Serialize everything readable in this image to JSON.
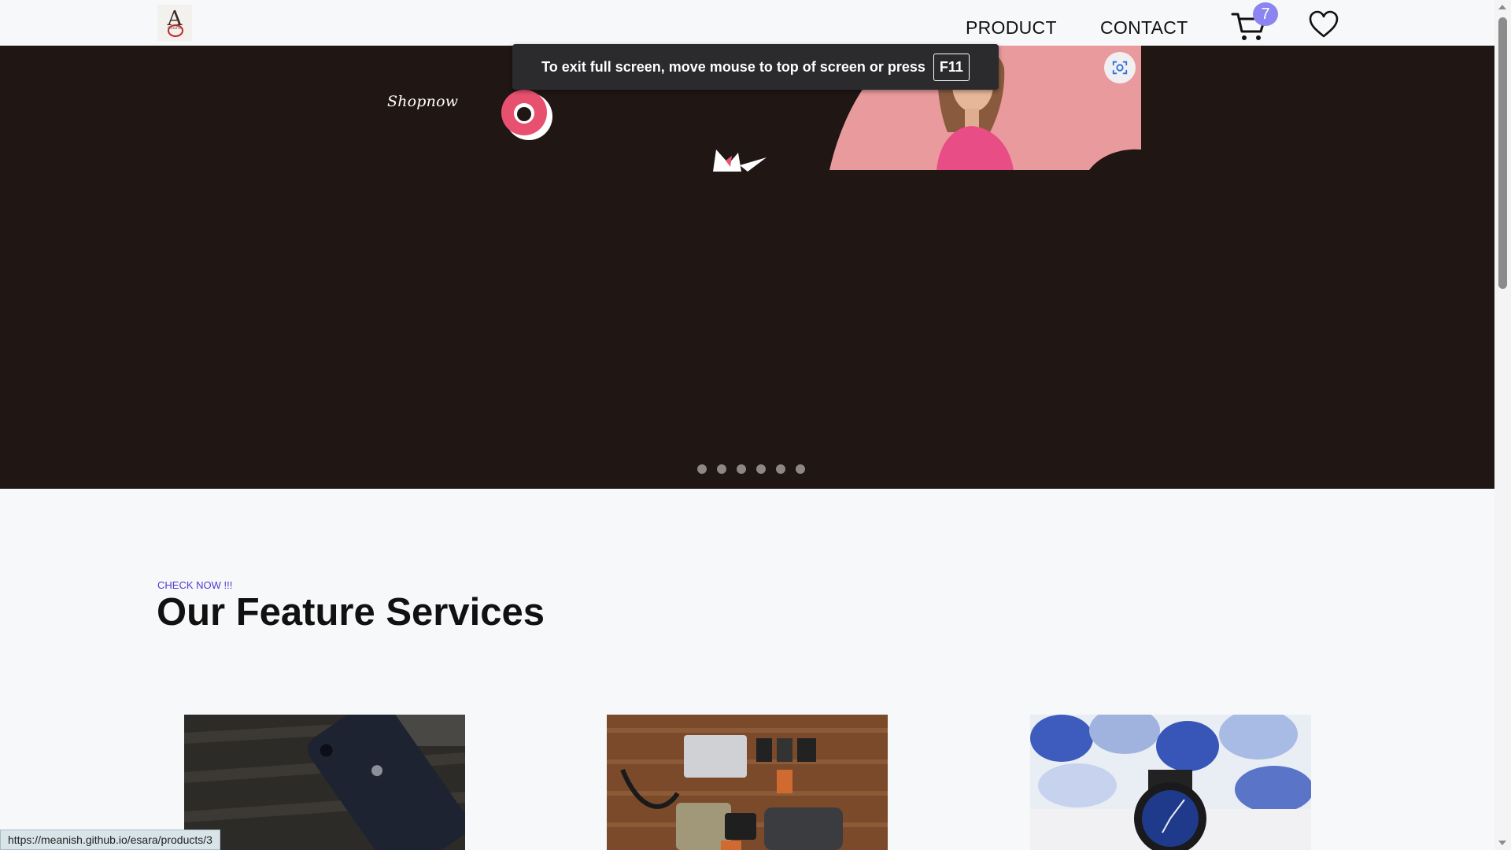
{
  "navbar": {
    "logo_icon": "esara-logo",
    "links": [
      {
        "label": "PRODUCT"
      },
      {
        "label": "CONTACT"
      }
    ],
    "cart_icon": "cart-icon",
    "cart_count": "7",
    "wishlist_icon": "heart-icon"
  },
  "hero": {
    "brand_text": "Shopnow",
    "slide_count": 6,
    "colors": {
      "background": "#201614",
      "accent": "#e8506f",
      "panel": "#e99a9c"
    }
  },
  "fullscreen_notice": {
    "message": "To exit full screen, move mouse to top of screen or press",
    "key": "F11"
  },
  "features": {
    "eyebrow": "CHECK NOW !!!",
    "title": "Our Feature Services",
    "cards": [
      {
        "image": "phone-photo"
      },
      {
        "image": "camera-bag-flatlay-photo"
      },
      {
        "image": "smartwatch-photo"
      }
    ]
  },
  "status_bar": {
    "url": "https://meanish.github.io/esara/products/3"
  }
}
